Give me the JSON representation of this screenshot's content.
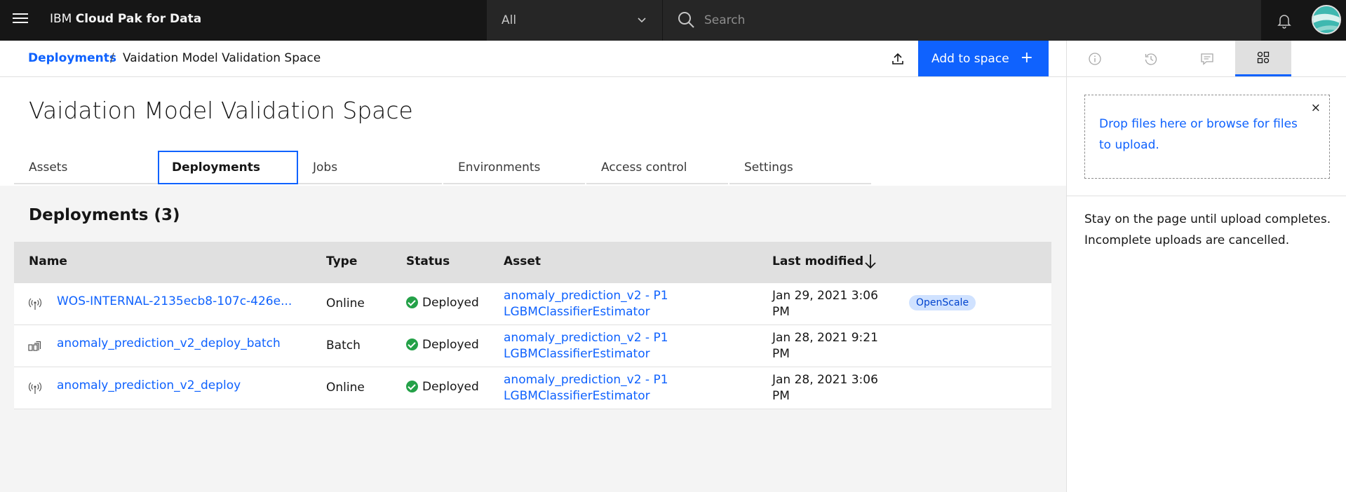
{
  "header": {
    "brand_prefix": "IBM",
    "brand_name": "Cloud Pak for Data",
    "scope_value": "All",
    "search_placeholder": "Search"
  },
  "breadcrumb": {
    "parent": "Deployments",
    "separator": "/",
    "current": "Vaidation Model Validation Space"
  },
  "toolbar": {
    "add_label": "Add to space",
    "add_icon": "+"
  },
  "page": {
    "title": "Vaidation Model Validation Space"
  },
  "tabs": [
    {
      "label": "Assets"
    },
    {
      "label": "Deployments"
    },
    {
      "label": "Jobs"
    },
    {
      "label": "Environments"
    },
    {
      "label": "Access control"
    },
    {
      "label": "Settings"
    }
  ],
  "deployments": {
    "title": "Deployments (3)",
    "columns": {
      "name": "Name",
      "type": "Type",
      "status": "Status",
      "asset": "Asset",
      "modified": "Last modified"
    },
    "rows": [
      {
        "name": "WOS-INTERNAL-2135ecb8-107c-426e...",
        "type": "Online",
        "status": "Deployed",
        "asset_line1": "anomaly_prediction_v2 - P1",
        "asset_line2": "LGBMClassifierEstimator",
        "modified_line1": "Jan 29, 2021 3:06",
        "modified_line2": "PM",
        "tag": "OpenScale"
      },
      {
        "name": "anomaly_prediction_v2_deploy_batch",
        "type": "Batch",
        "status": "Deployed",
        "asset_line1": "anomaly_prediction_v2 - P1",
        "asset_line2": "LGBMClassifierEstimator",
        "modified_line1": "Jan 28, 2021 9:21",
        "modified_line2": "PM"
      },
      {
        "name": "anomaly_prediction_v2_deploy",
        "type": "Online",
        "status": "Deployed",
        "asset_line1": "anomaly_prediction_v2 - P1",
        "asset_line2": "LGBMClassifierEstimator",
        "modified_line1": "Jan 28, 2021 3:06",
        "modified_line2": "PM"
      }
    ]
  },
  "panel": {
    "dropzone_text": "Drop files here or browse for files to upload.",
    "close_icon": "×",
    "note": "Stay on the page until upload completes. Incomplete uploads are cancelled."
  },
  "colors": {
    "accent": "#0f62fe",
    "header_bg": "#161616",
    "success": "#24a148",
    "tag_bg": "#d0e2ff"
  }
}
